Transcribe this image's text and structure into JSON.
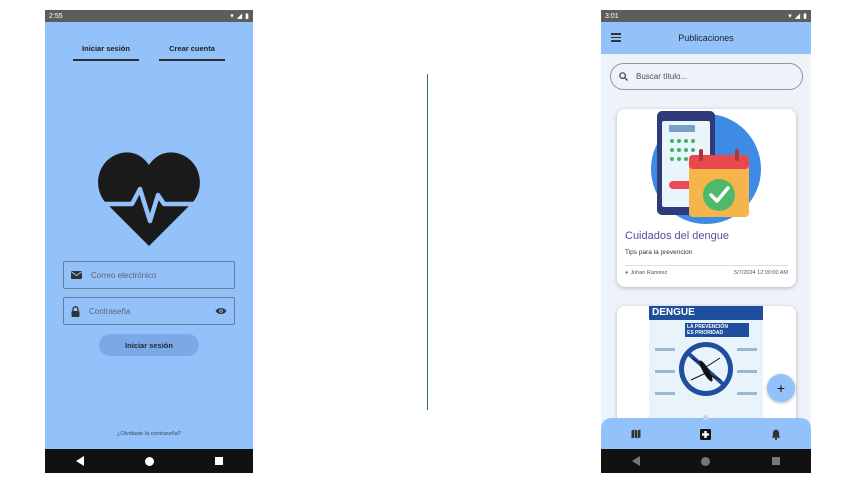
{
  "left_screen": {
    "status_time": "2:55",
    "tabs": [
      "Iniciar sesión",
      "Crear cuenta"
    ],
    "email_placeholder": "Correo electrónico",
    "password_placeholder": "Contraseña",
    "login_button": "Iniciar sesión",
    "forgot_link": "¿Olvidaste la contraseña?"
  },
  "right_screen": {
    "status_time": "3:01",
    "title": "Publicaciones",
    "search_placeholder": "Buscar título...",
    "post": {
      "title": "Cuidados del dengue",
      "subtitle": "Tips para la prevencion",
      "author": "Johan Ramirez",
      "date": "5/7/2024 12:00:00 AM"
    },
    "poster": {
      "heading": "DENGUE",
      "badge_line1": "LA PREVENCIÓN",
      "badge_line2": "ES PRIORIDAD"
    },
    "fab_label": "+"
  },
  "colors": {
    "accent": "#93c2fb",
    "card_title": "#5c4ba3"
  }
}
